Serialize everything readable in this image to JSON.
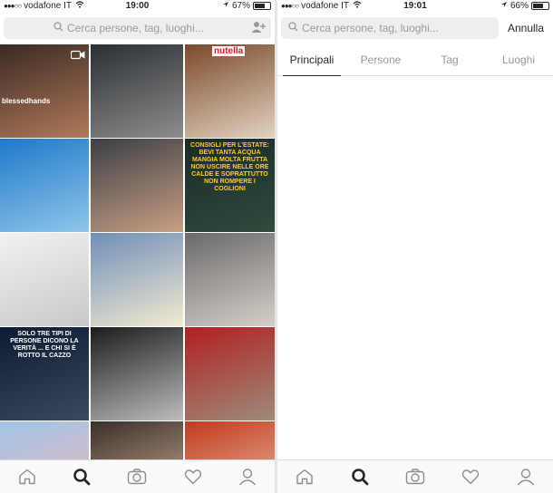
{
  "left": {
    "status": {
      "carrier": "vodafone IT",
      "time": "19:00",
      "battery": "67%",
      "battery_level": 0.67
    },
    "search": {
      "placeholder": "Cerca persone, tag, luoghi..."
    },
    "grid": {
      "tiles": [
        {
          "name": "tile-eyebrow",
          "colors": [
            "#3a2a22",
            "#b07a5a"
          ],
          "caption": "blessedhands"
        },
        {
          "name": "tile-car-selfie",
          "colors": [
            "#2b2f33",
            "#8d8d8d"
          ],
          "caption": ""
        },
        {
          "name": "tile-nutella-crepes",
          "colors": [
            "#7a4a2a",
            "#e2d2c0"
          ],
          "caption": "nutella"
        },
        {
          "name": "tile-sea-cliff",
          "colors": [
            "#1e79c8",
            "#8fc6ea"
          ],
          "caption": ""
        },
        {
          "name": "tile-thumbs-up-selfie",
          "colors": [
            "#3b3f46",
            "#c89f82"
          ],
          "caption": ""
        },
        {
          "name": "tile-summer-tips",
          "colors": [
            "#1a2b25",
            "#2f4a3e"
          ],
          "caption": "CONSIGLI PER L'ESTATE: BEVI TANTA ACQUA MANGIA MOLTA FRUTTA NON USCIRE NELLE ORE CALDE E SOPRATTUTTO NON ROMPERE I COGLIONI"
        },
        {
          "name": "tile-wedding-couple",
          "colors": [
            "#f2f2f2",
            "#c8c8c8"
          ],
          "caption": ""
        },
        {
          "name": "tile-sun-flower",
          "colors": [
            "#6f8fb8",
            "#f3ead0"
          ],
          "caption": ""
        },
        {
          "name": "tile-woman-coffee",
          "colors": [
            "#6a6a6a",
            "#d6cfc9"
          ],
          "caption": ""
        },
        {
          "name": "tile-quote-night",
          "colors": [
            "#0c1a33",
            "#3a4a5e"
          ],
          "caption": "SOLO TRE TIPI DI PERSONE DICONO LA VERITÀ ... E CHI SI È ROTTO IL CAZZO"
        },
        {
          "name": "tile-vintage-couple",
          "colors": [
            "#1c1c1c",
            "#bdbdbd"
          ],
          "caption": ""
        },
        {
          "name": "tile-red-fan",
          "colors": [
            "#b11f1f",
            "#9e8b7a"
          ],
          "caption": ""
        },
        {
          "name": "tile-pink-building",
          "colors": [
            "#9fc5e8",
            "#f2b6b6"
          ],
          "caption": ""
        },
        {
          "name": "tile-mirror-selfie",
          "colors": [
            "#3a2f2a",
            "#d7b79a"
          ],
          "caption": ""
        },
        {
          "name": "tile-red-quote",
          "colors": [
            "#c4391f",
            "#e8c7a8"
          ],
          "caption": ""
        }
      ]
    },
    "tabbar": [
      {
        "name": "home-icon",
        "active": false
      },
      {
        "name": "search-icon",
        "active": true
      },
      {
        "name": "camera-icon",
        "active": false
      },
      {
        "name": "heart-icon",
        "active": false
      },
      {
        "name": "profile-icon",
        "active": false
      }
    ]
  },
  "right": {
    "status": {
      "carrier": "vodafone IT",
      "time": "19:01",
      "battery": "66%",
      "battery_level": 0.66
    },
    "search": {
      "placeholder": "Cerca persone, tag, luoghi...",
      "cancel_label": "Annulla"
    },
    "tabs": [
      "Principali",
      "Persone",
      "Tag",
      "Luoghi"
    ],
    "active_tab": "Principali",
    "tabbar": [
      {
        "name": "home-icon",
        "active": false
      },
      {
        "name": "search-icon",
        "active": true
      },
      {
        "name": "camera-icon",
        "active": false
      },
      {
        "name": "heart-icon",
        "active": false
      },
      {
        "name": "profile-icon",
        "active": false
      }
    ]
  },
  "colors": {
    "text": "#262626",
    "muted": "#999999",
    "search_bg": "#eeeeee",
    "divider": "#e5e5e5"
  }
}
